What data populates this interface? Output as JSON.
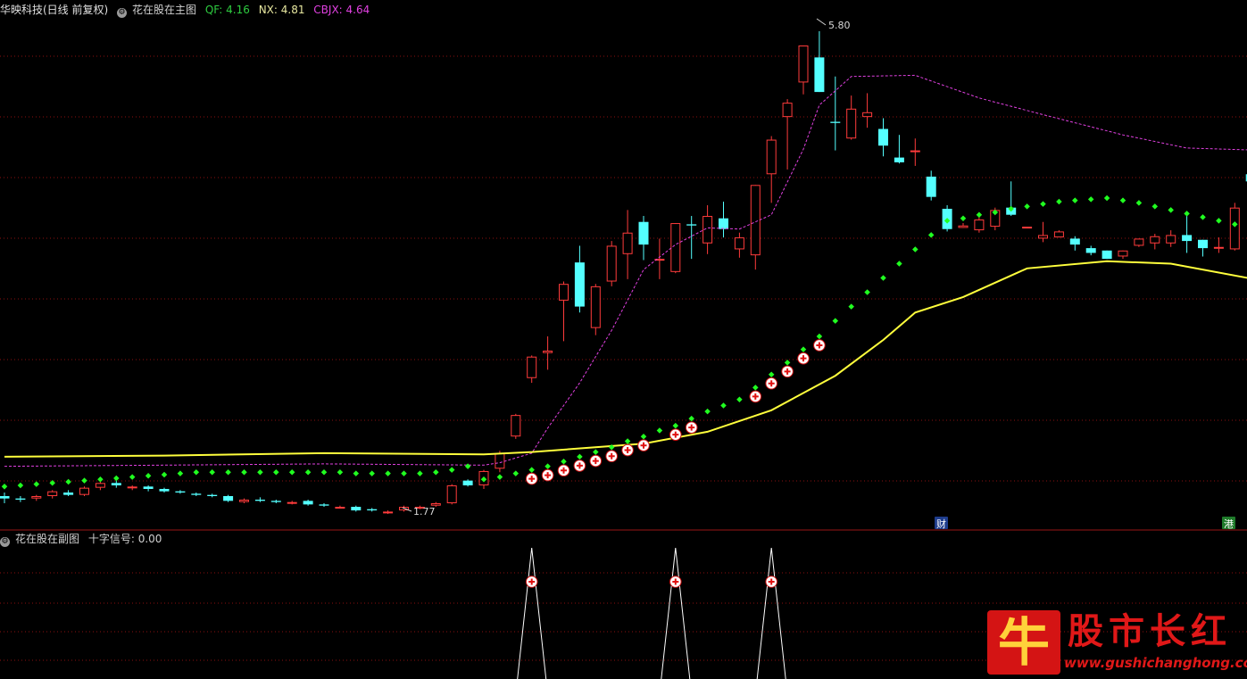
{
  "header": {
    "stock_name": "华映科技(日线 前复权)",
    "main_indicator": "花在股在主图",
    "qf_label": "QF: 4.16",
    "nx_label": "NX: 4.81",
    "cbjx_label": "CBJX: 4.64"
  },
  "sub_header": {
    "indicator": "花在股在副图",
    "signal_label": "十字信号: 0.00"
  },
  "markers": {
    "cai": "财",
    "gang": "港"
  },
  "watermark": {
    "logo": "牛",
    "name": "股市长红",
    "url": "www.gushichanghong.com"
  },
  "colors": {
    "background": "#000000",
    "up_candle": "#ff3b3b",
    "down_candle": "#54ffff",
    "yellow_line": "#ffff3c",
    "purple_line": "#e040e0",
    "green_dots": "#20ff20",
    "grid": "#8b1010",
    "qf": "#2ecc40",
    "nx": "#e8e8a0",
    "cbjx": "#e040e0"
  },
  "chart_data": {
    "type": "candlestick",
    "price_labels": {
      "high": "5.80",
      "low": "1.77"
    },
    "candles": [
      [
        1.9,
        1.88,
        1.93,
        1.84
      ],
      [
        1.88,
        1.87,
        1.9,
        1.85
      ],
      [
        1.88,
        1.9,
        1.91,
        1.86
      ],
      [
        1.9,
        1.94,
        1.95,
        1.88
      ],
      [
        1.93,
        1.91,
        1.95,
        1.9
      ],
      [
        1.91,
        1.97,
        1.98,
        1.9
      ],
      [
        1.97,
        2.01,
        2.03,
        1.95
      ],
      [
        2.01,
        1.99,
        2.03,
        1.97
      ],
      [
        1.98,
        1.98,
        1.99,
        1.95
      ],
      [
        1.98,
        1.96,
        1.99,
        1.94
      ],
      [
        1.96,
        1.94,
        1.97,
        1.93
      ],
      [
        1.94,
        1.93,
        1.95,
        1.92
      ],
      [
        1.92,
        1.91,
        1.93,
        1.9
      ],
      [
        1.91,
        1.9,
        1.92,
        1.89
      ],
      [
        1.9,
        1.86,
        1.91,
        1.85
      ],
      [
        1.85,
        1.87,
        1.88,
        1.84
      ],
      [
        1.87,
        1.86,
        1.89,
        1.85
      ],
      [
        1.86,
        1.85,
        1.87,
        1.84
      ],
      [
        1.85,
        1.85,
        1.86,
        1.83
      ],
      [
        1.86,
        1.83,
        1.87,
        1.82
      ],
      [
        1.83,
        1.82,
        1.84,
        1.81
      ],
      [
        1.81,
        1.81,
        1.82,
        1.8
      ],
      [
        1.81,
        1.78,
        1.82,
        1.77
      ],
      [
        1.79,
        1.78,
        1.8,
        1.77
      ],
      [
        1.77,
        1.77,
        1.78,
        1.75
      ],
      [
        1.78,
        1.81,
        1.82,
        1.77
      ],
      [
        1.8,
        1.81,
        1.82,
        1.79
      ],
      [
        1.82,
        1.84,
        1.85,
        1.81
      ],
      [
        1.84,
        1.99,
        2.0,
        1.83
      ],
      [
        2.03,
        1.99,
        2.04,
        1.98
      ],
      [
        1.99,
        2.11,
        2.12,
        1.96
      ],
      [
        2.13,
        2.26,
        2.28,
        2.1
      ],
      [
        2.4,
        2.58,
        2.59,
        2.38
      ],
      [
        2.89,
        3.07,
        3.08,
        2.85
      ],
      [
        3.1,
        3.12,
        3.24,
        2.96
      ],
      [
        3.54,
        3.68,
        3.7,
        3.2
      ],
      [
        3.86,
        3.49,
        4.0,
        3.44
      ],
      [
        3.31,
        3.66,
        3.68,
        3.25
      ],
      [
        3.7,
        4.0,
        4.04,
        3.66
      ],
      [
        3.93,
        4.11,
        4.3,
        3.72
      ],
      [
        4.2,
        4.01,
        4.25,
        3.88
      ],
      [
        3.88,
        3.89,
        4.06,
        3.72
      ],
      [
        3.78,
        4.19,
        4.19,
        3.77
      ],
      [
        4.18,
        4.17,
        4.25,
        3.89
      ],
      [
        4.02,
        4.25,
        4.34,
        3.93
      ],
      [
        4.23,
        4.14,
        4.37,
        4.07
      ],
      [
        3.97,
        4.07,
        4.11,
        3.9
      ],
      [
        3.92,
        4.51,
        4.51,
        3.8
      ],
      [
        4.6,
        4.89,
        4.92,
        4.36
      ],
      [
        5.08,
        5.2,
        5.23,
        4.64
      ],
      [
        5.37,
        5.68,
        5.68,
        5.27
      ],
      [
        5.58,
        5.29,
        5.8,
        5.29
      ],
      [
        5.04,
        5.03,
        5.42,
        4.8
      ],
      [
        4.9,
        5.15,
        5.26,
        4.89
      ],
      [
        5.08,
        5.12,
        5.28,
        4.99
      ],
      [
        4.98,
        4.84,
        5.07,
        4.75
      ],
      [
        4.74,
        4.7,
        4.93,
        4.69
      ],
      [
        4.79,
        4.8,
        4.9,
        4.67
      ],
      [
        4.58,
        4.41,
        4.63,
        4.38
      ],
      [
        4.31,
        4.14,
        4.34,
        4.12
      ],
      [
        4.15,
        4.17,
        4.19,
        4.15
      ],
      [
        4.13,
        4.22,
        4.26,
        4.11
      ],
      [
        4.16,
        4.3,
        4.32,
        4.13
      ],
      [
        4.32,
        4.26,
        4.54,
        4.25
      ],
      [
        4.16,
        4.16,
        4.16,
        4.16
      ],
      [
        4.06,
        4.09,
        4.2,
        4.03
      ],
      [
        4.07,
        4.12,
        4.13,
        4.08
      ],
      [
        4.06,
        4.01,
        4.08,
        3.96
      ],
      [
        3.98,
        3.94,
        4.0,
        3.92
      ],
      [
        3.96,
        3.89,
        3.96,
        3.89
      ],
      [
        3.91,
        3.96,
        3.96,
        3.89
      ],
      [
        4.0,
        4.06,
        4.06,
        3.99
      ],
      [
        4.02,
        4.08,
        4.1,
        3.97
      ],
      [
        4.02,
        4.09,
        4.13,
        3.99
      ],
      [
        4.09,
        4.04,
        4.25,
        3.94
      ],
      [
        4.05,
        3.98,
        4.05,
        3.91
      ],
      [
        3.98,
        3.99,
        4.07,
        3.94
      ],
      [
        3.97,
        4.32,
        4.36,
        3.96
      ],
      [
        4.6,
        4.54,
        4.75,
        4.29
      ],
      [
        4.52,
        4.47,
        4.56,
        4.42
      ]
    ],
    "yellow_line": [
      [
        0,
        2.23
      ],
      [
        10,
        2.24
      ],
      [
        20,
        2.26
      ],
      [
        30,
        2.25
      ],
      [
        33,
        2.27
      ],
      [
        40,
        2.34
      ],
      [
        44,
        2.44
      ],
      [
        48,
        2.62
      ],
      [
        52,
        2.91
      ],
      [
        55,
        3.21
      ],
      [
        57,
        3.44
      ],
      [
        60,
        3.57
      ],
      [
        64,
        3.81
      ],
      [
        69,
        3.87
      ],
      [
        73,
        3.85
      ],
      [
        79,
        3.7
      ]
    ],
    "purple_line": [
      [
        0,
        2.15
      ],
      [
        10,
        2.16
      ],
      [
        20,
        2.17
      ],
      [
        30,
        2.16
      ],
      [
        31,
        2.18
      ],
      [
        33,
        2.26
      ],
      [
        34,
        2.47
      ],
      [
        36,
        2.85
      ],
      [
        38,
        3.29
      ],
      [
        40,
        3.8
      ],
      [
        42,
        4.01
      ],
      [
        44,
        4.15
      ],
      [
        46,
        4.14
      ],
      [
        48,
        4.26
      ],
      [
        50,
        4.81
      ],
      [
        51,
        5.18
      ],
      [
        53,
        5.42
      ],
      [
        57,
        5.43
      ],
      [
        61,
        5.24
      ],
      [
        65,
        5.1
      ],
      [
        70,
        4.93
      ],
      [
        74,
        4.82
      ],
      [
        79,
        4.8
      ]
    ],
    "green_dots": [
      1.98,
      1.99,
      2.0,
      2.01,
      2.02,
      2.03,
      2.04,
      2.05,
      2.06,
      2.07,
      2.08,
      2.09,
      2.1,
      2.1,
      2.1,
      2.1,
      2.1,
      2.1,
      2.1,
      2.1,
      2.1,
      2.1,
      2.09,
      2.09,
      2.09,
      2.09,
      2.09,
      2.1,
      2.12,
      2.15,
      2.04,
      2.06,
      2.09,
      2.12,
      2.15,
      2.19,
      2.23,
      2.27,
      2.31,
      2.36,
      2.4,
      2.45,
      2.49,
      2.55,
      2.61,
      2.66,
      2.71,
      2.81,
      2.92,
      3.02,
      3.13,
      3.24,
      3.37,
      3.49,
      3.61,
      3.73,
      3.85,
      3.97,
      4.09,
      4.21,
      4.23,
      4.26,
      4.28,
      4.31,
      4.33,
      4.35,
      4.37,
      4.38,
      4.39,
      4.4,
      4.38,
      4.36,
      4.33,
      4.3,
      4.27,
      4.24,
      4.21,
      4.18,
      4.15,
      4.12
    ],
    "cross_signals": [
      33,
      34,
      35,
      36,
      37,
      38,
      39,
      40,
      42,
      43,
      47,
      48,
      49,
      50,
      51
    ],
    "sub_signals": [
      33,
      42,
      48
    ]
  }
}
